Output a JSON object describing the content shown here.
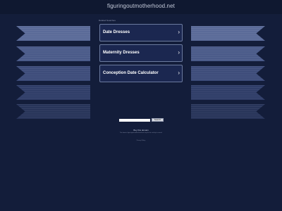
{
  "header": {
    "domain": "figuringoutmotherhood.net"
  },
  "related": {
    "heading": "Related Searches",
    "links": [
      {
        "label": "Date Dresses",
        "arrow": "›"
      },
      {
        "label": "Maternity Dresses",
        "arrow": "›"
      },
      {
        "label": "Conception Date Calculator",
        "arrow": "›"
      }
    ]
  },
  "search": {
    "value": "",
    "button_label": "Search"
  },
  "footer": {
    "buy_link": "Buy this domain",
    "disclaimer": "The domain figuringoutmotherhood.net may be for sale by its owner!",
    "privacy": "Privacy Policy"
  },
  "colors": {
    "background": "#131d3a",
    "box_border": "#6b7a9e"
  }
}
